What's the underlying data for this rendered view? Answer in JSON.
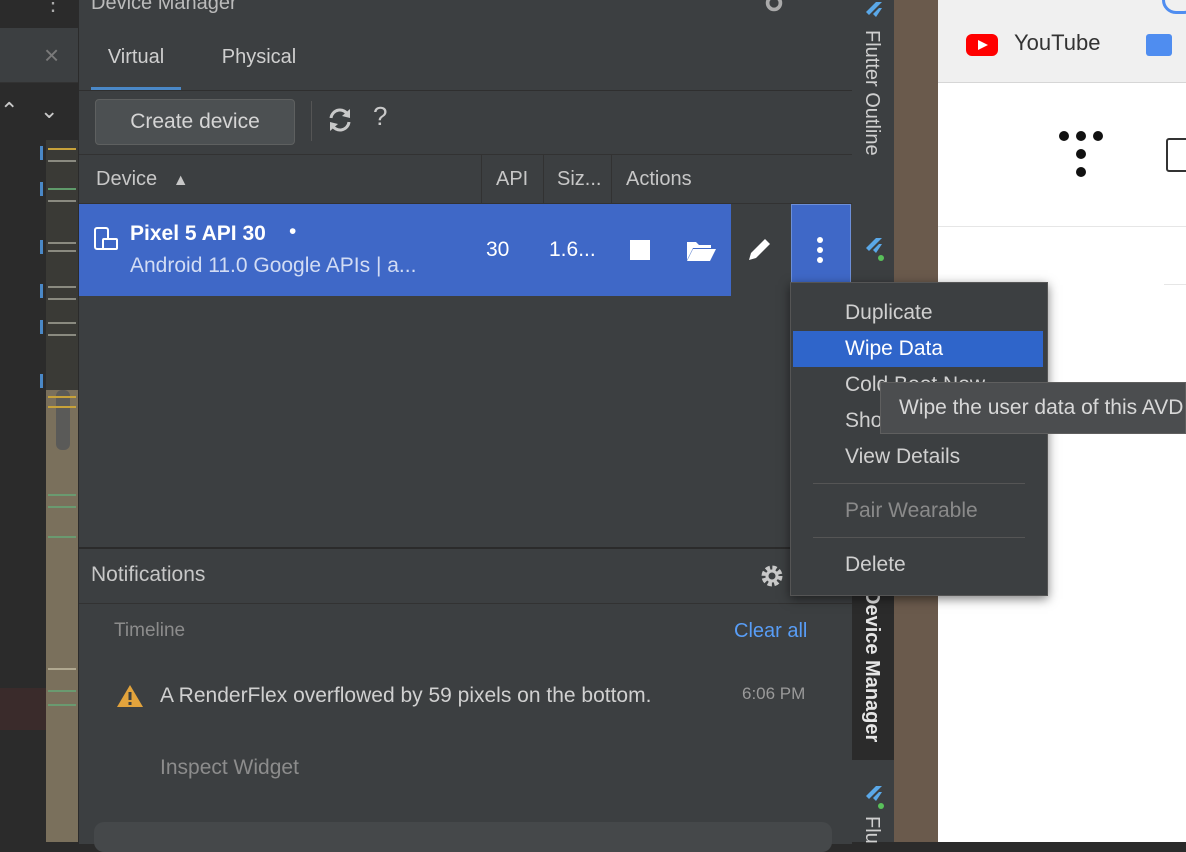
{
  "panel": {
    "title": "Device Manager"
  },
  "tabs": [
    {
      "label": "Virtual",
      "active": true
    },
    {
      "label": "Physical",
      "active": false
    }
  ],
  "toolbar": {
    "create_label": "Create device",
    "help_label": "?"
  },
  "table": {
    "columns": [
      "Device",
      "API",
      "Siz...",
      "Actions"
    ],
    "rows": [
      {
        "name": "Pixel 5 API 30",
        "status_dot": "•",
        "subtitle": "Android 11.0 Google APIs | a...",
        "api": "30",
        "size": "1.6..."
      }
    ]
  },
  "menu": {
    "items": [
      "Duplicate",
      "Wipe Data",
      "Cold Boot Now",
      "Show on Disk",
      "View Details",
      "Pair Wearable",
      "Delete"
    ],
    "selected": "Wipe Data",
    "disabled": [
      "Pair Wearable"
    ]
  },
  "tooltip": "Wipe the user data of this AVD",
  "notifications": {
    "title": "Notifications",
    "timeline_label": "Timeline",
    "clear_all": "Clear all",
    "items": [
      {
        "message": "A RenderFlex overflowed by 59 pixels on the bottom.",
        "time": "6:06 PM",
        "action": "Inspect Widget"
      }
    ]
  },
  "side_tabs": {
    "flutter_outline": "Flutter Outline",
    "device_manager": "Device Manager",
    "flutter": "Flu"
  },
  "browser": {
    "bookmark": "YouTube"
  },
  "colors": {
    "selection": "#3f68c7",
    "menu_selected": "#2f65ca",
    "link": "#589df6",
    "warning": "#e2a33c"
  }
}
